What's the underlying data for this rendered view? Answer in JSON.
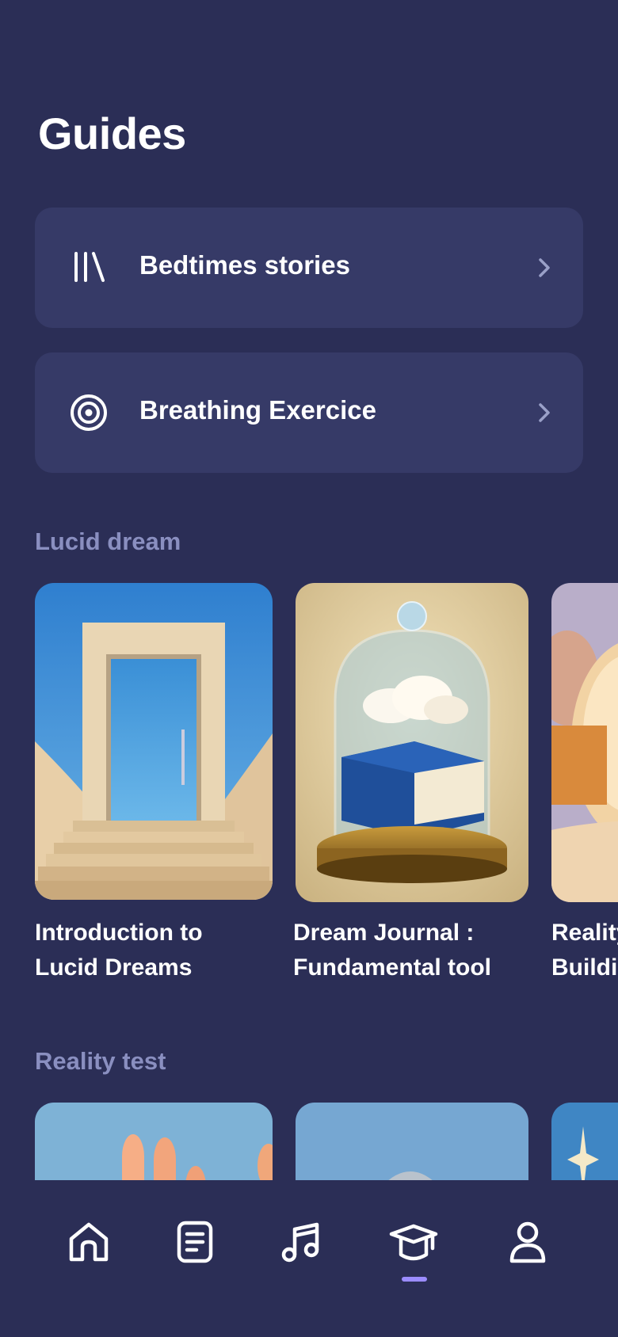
{
  "header": {
    "title": "Guides"
  },
  "guides": [
    {
      "label": "Bedtimes stories",
      "icon": "library-icon"
    },
    {
      "label": "Breathing Exercice",
      "icon": "target-icon"
    }
  ],
  "sections": [
    {
      "title": "Lucid dream",
      "cards": [
        {
          "line1": "Introduction to",
          "line2": "Lucid Dreams"
        },
        {
          "line1": "Dream Journal :",
          "line2": "Fundamental tool"
        },
        {
          "line1": "Reality",
          "line2": "Building"
        }
      ]
    },
    {
      "title": "Reality test"
    }
  ],
  "tabbar": {
    "items": [
      "home-icon",
      "document-icon",
      "music-icon",
      "graduation-cap-icon",
      "user-icon"
    ],
    "active": "graduation-cap-icon"
  },
  "colors": {
    "background": "#2b2e56",
    "card": "#363a67",
    "accent": "#9b8cff",
    "section_title": "#8a8fc0"
  }
}
